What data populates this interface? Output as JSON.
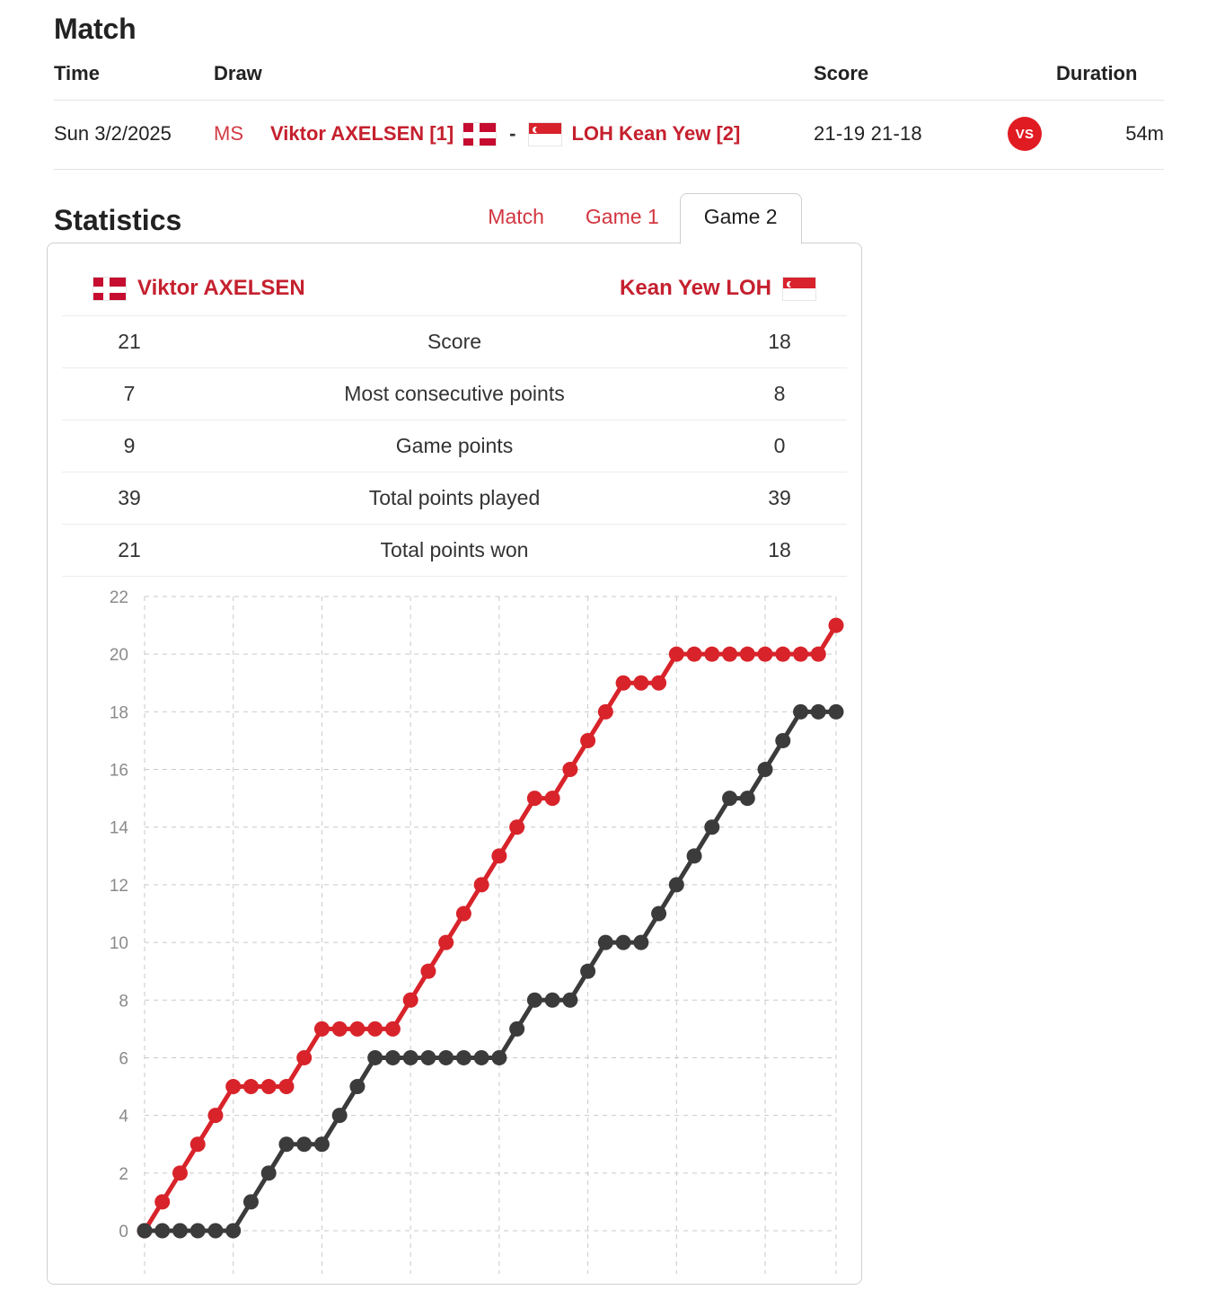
{
  "match": {
    "heading": "Match",
    "columns": {
      "time": "Time",
      "draw": "Draw",
      "score": "Score",
      "duration": "Duration"
    },
    "row": {
      "time": "Sun 3/2/2025",
      "draw_code": "MS",
      "player1": "Viktor AXELSEN [1]",
      "player1_flag": "denmark-flag",
      "separator": "-",
      "player2": "LOH Kean Yew [2]",
      "player2_flag": "singapore-flag",
      "score": "21-19 21-18",
      "badge": "VS",
      "duration": "54m"
    }
  },
  "statistics": {
    "heading": "Statistics",
    "tabs": [
      {
        "label": "Match",
        "active": false
      },
      {
        "label": "Game 1",
        "active": false
      },
      {
        "label": "Game 2",
        "active": true
      }
    ],
    "players": {
      "left": "Viktor AXELSEN",
      "right": "Kean Yew LOH"
    },
    "rows": [
      {
        "left": "21",
        "label": "Score",
        "right": "18"
      },
      {
        "left": "7",
        "label": "Most consecutive points",
        "right": "8"
      },
      {
        "left": "9",
        "label": "Game points",
        "right": "0"
      },
      {
        "left": "39",
        "label": "Total points played",
        "right": "39"
      },
      {
        "left": "21",
        "label": "Total points won",
        "right": "18"
      }
    ]
  },
  "chart_data": {
    "type": "line",
    "title": "",
    "xlabel": "",
    "ylabel": "",
    "ylim": [
      0,
      22
    ],
    "yticks": [
      0,
      2,
      4,
      6,
      8,
      10,
      12,
      14,
      16,
      18,
      20,
      22
    ],
    "xlim": [
      0,
      39
    ],
    "grid": true,
    "legend": "none",
    "colors": {
      "axelsen": "#d8232a",
      "loh": "#3b3b3b"
    },
    "x": [
      0,
      1,
      2,
      3,
      4,
      5,
      6,
      7,
      8,
      9,
      10,
      11,
      12,
      13,
      14,
      15,
      16,
      17,
      18,
      19,
      20,
      21,
      22,
      23,
      24,
      25,
      26,
      27,
      28,
      29,
      30,
      31,
      32,
      33,
      34,
      35,
      36,
      37,
      38,
      39
    ],
    "series": [
      {
        "name": "Viktor AXELSEN",
        "color": "#d8232a",
        "values": [
          0,
          1,
          2,
          3,
          4,
          5,
          5,
          5,
          5,
          6,
          7,
          7,
          7,
          7,
          7,
          8,
          9,
          10,
          11,
          12,
          13,
          14,
          15,
          15,
          16,
          17,
          18,
          19,
          19,
          19,
          20,
          20,
          20,
          20,
          20,
          20,
          20,
          20,
          20,
          21
        ]
      },
      {
        "name": "Kean Yew LOH",
        "color": "#3b3b3b",
        "values": [
          0,
          0,
          0,
          0,
          0,
          0,
          1,
          2,
          3,
          3,
          3,
          4,
          5,
          6,
          6,
          6,
          6,
          6,
          6,
          6,
          6,
          7,
          8,
          8,
          8,
          9,
          10,
          10,
          10,
          11,
          12,
          13,
          14,
          15,
          15,
          16,
          17,
          18,
          18,
          18
        ]
      }
    ]
  }
}
